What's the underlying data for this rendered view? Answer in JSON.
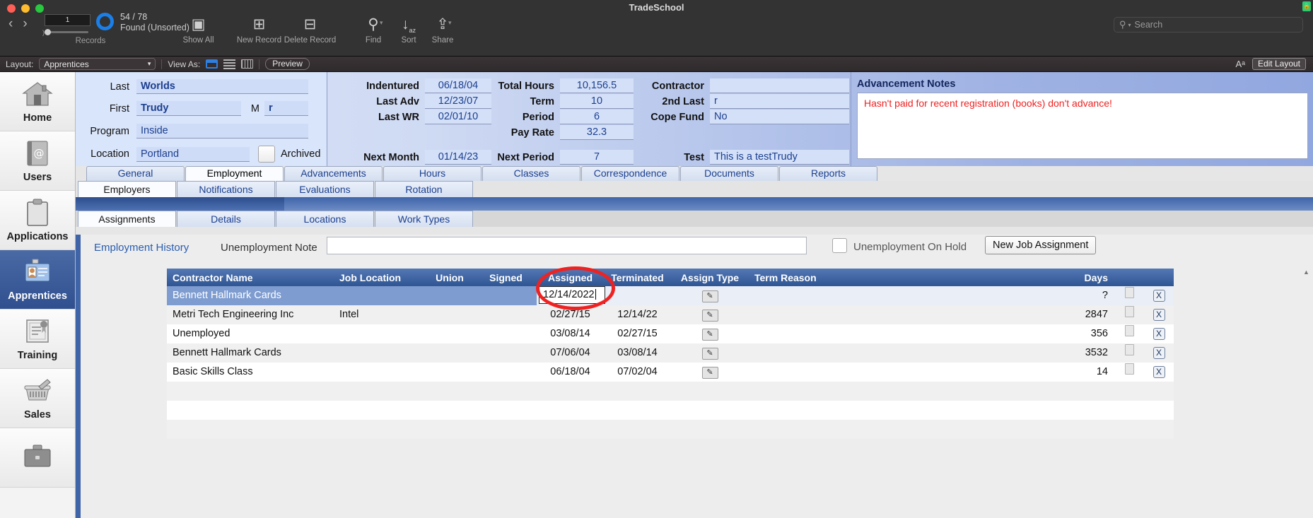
{
  "window": {
    "title": "TradeSchool"
  },
  "toolbar": {
    "slider_value": "1",
    "record_count": "54 / 78",
    "record_status": "Found (Unsorted)",
    "records_label": "Records",
    "items": [
      {
        "icon": "show-all-icon",
        "label": "Show All",
        "glyph": "❐"
      },
      {
        "icon": "new-record-icon",
        "label": "New Record",
        "glyph": "⊞"
      },
      {
        "icon": "delete-record-icon",
        "label": "Delete Record",
        "glyph": "⊟"
      },
      {
        "icon": "find-icon",
        "label": "Find",
        "glyph": "⚲"
      },
      {
        "icon": "sort-icon",
        "label": "Sort",
        "glyph": "↓"
      },
      {
        "icon": "share-icon",
        "label": "Share",
        "glyph": "⇧"
      }
    ],
    "search_placeholder": "Search"
  },
  "layoutbar": {
    "layout_label": "Layout:",
    "layout_value": "Apprentices",
    "view_as_label": "View As:",
    "preview_label": "Preview",
    "edit_layout_label": "Edit Layout",
    "font_size_label": "Aᵃ"
  },
  "sidebar": {
    "items": [
      {
        "label": "Home",
        "icon": "house-icon",
        "active": false
      },
      {
        "label": "Users",
        "icon": "address-book-icon",
        "active": false
      },
      {
        "label": "Applications",
        "icon": "clipboard-icon",
        "active": false
      },
      {
        "label": "Apprentices",
        "icon": "id-badge-icon",
        "active": true
      },
      {
        "label": "Training",
        "icon": "certificate-icon",
        "active": false
      },
      {
        "label": "Sales",
        "icon": "basket-icon",
        "active": false
      },
      {
        "label": "",
        "icon": "briefcase-icon",
        "active": false
      }
    ]
  },
  "header_form": {
    "left": {
      "last_label": "Last",
      "last_value": "Worlds",
      "first_label": "First",
      "first_value": "Trudy",
      "middle_label": "M",
      "middle_value": "r",
      "program_label": "Program",
      "program_value": "Inside",
      "location_label": "Location",
      "location_value": "Portland",
      "archived_label": "Archived"
    },
    "mid": {
      "indentured_label": "Indentured",
      "indentured_value": "06/18/04",
      "last_adv_label": "Last Adv",
      "last_adv_value": "12/23/07",
      "last_wr_label": "Last WR",
      "last_wr_value": "02/01/10",
      "total_hours_label": "Total Hours",
      "total_hours_value": "10,156.5",
      "term_label": "Term",
      "term_value": "10",
      "period_label": "Period",
      "period_value": "6",
      "pay_rate_label": "Pay Rate",
      "pay_rate_value": "32.3",
      "contractor_label": "Contractor",
      "contractor_value": "",
      "second_last_label": "2nd Last",
      "second_last_value": "r",
      "cope_fund_label": "Cope Fund",
      "cope_fund_value": "No",
      "next_month_label": "Next Month",
      "next_month_value": "01/14/23",
      "next_period_label": "Next Period",
      "next_period_value": "7",
      "test_label": "Test",
      "test_value": "This is a testTrudy"
    },
    "notes": {
      "title": "Advancement Notes",
      "text": "Hasn't paid for recent registration (books) don't advance!",
      "color": "#ef2020"
    }
  },
  "tabs_primary": [
    {
      "label": "General",
      "selected": false
    },
    {
      "label": "Employment",
      "selected": true
    },
    {
      "label": "Advancements",
      "selected": false
    },
    {
      "label": "Hours",
      "selected": false
    },
    {
      "label": "Classes",
      "selected": false
    },
    {
      "label": "Correspondence",
      "selected": false
    },
    {
      "label": "Documents",
      "selected": false
    },
    {
      "label": "Reports",
      "selected": false
    }
  ],
  "tabs_secondary": [
    {
      "label": "Employers",
      "selected": true
    },
    {
      "label": "Notifications",
      "selected": false
    },
    {
      "label": "Evaluations",
      "selected": false
    },
    {
      "label": "Rotation",
      "selected": false
    }
  ],
  "tabs_tertiary": [
    {
      "label": "Assignments",
      "selected": true
    },
    {
      "label": "Details",
      "selected": false
    },
    {
      "label": "Locations",
      "selected": false
    },
    {
      "label": "Work Types",
      "selected": false
    }
  ],
  "content": {
    "employment_history_link": "Employment History",
    "unemployment_note_label": "Unemployment Note",
    "unemployment_note_value": "",
    "unemployment_on_hold_label": "Unemployment On Hold",
    "unemployment_on_hold_checked": false,
    "new_job_assignment_label": "New Job Assignment"
  },
  "table": {
    "columns": [
      "Contractor Name",
      "Job Location",
      "Union",
      "Signed",
      "Assigned",
      "Terminated",
      "Assign Type",
      "Term Reason",
      "Days"
    ],
    "editing_cell": {
      "column": "Assigned",
      "value": "12/14/2022",
      "row": 0
    },
    "rows": [
      {
        "contractor": "Bennett Hallmark Cards",
        "location": "",
        "union": "",
        "signed": "",
        "assigned": "12/14/2022",
        "terminated": "",
        "assign_type": "edit",
        "term_reason": "",
        "days": "?",
        "selected": true
      },
      {
        "contractor": "Metri Tech Engineering Inc",
        "location": "Intel",
        "union": "",
        "signed": "",
        "assigned": "02/27/15",
        "terminated": "12/14/22",
        "assign_type": "edit",
        "term_reason": "",
        "days": "2847",
        "selected": false
      },
      {
        "contractor": "Unemployed",
        "location": "",
        "union": "",
        "signed": "",
        "assigned": "03/08/14",
        "terminated": "02/27/15",
        "assign_type": "edit",
        "term_reason": "",
        "days": "356",
        "selected": false
      },
      {
        "contractor": "Bennett Hallmark Cards",
        "location": "",
        "union": "",
        "signed": "",
        "assigned": "07/06/04",
        "terminated": "03/08/14",
        "assign_type": "edit",
        "term_reason": "",
        "days": "3532",
        "selected": false
      },
      {
        "contractor": "Basic Skills Class",
        "location": "",
        "union": "",
        "signed": "",
        "assigned": "06/18/04",
        "terminated": "07/02/04",
        "assign_type": "edit",
        "term_reason": "",
        "days": "14",
        "selected": false
      }
    ],
    "row_action_delete_label": "X"
  }
}
